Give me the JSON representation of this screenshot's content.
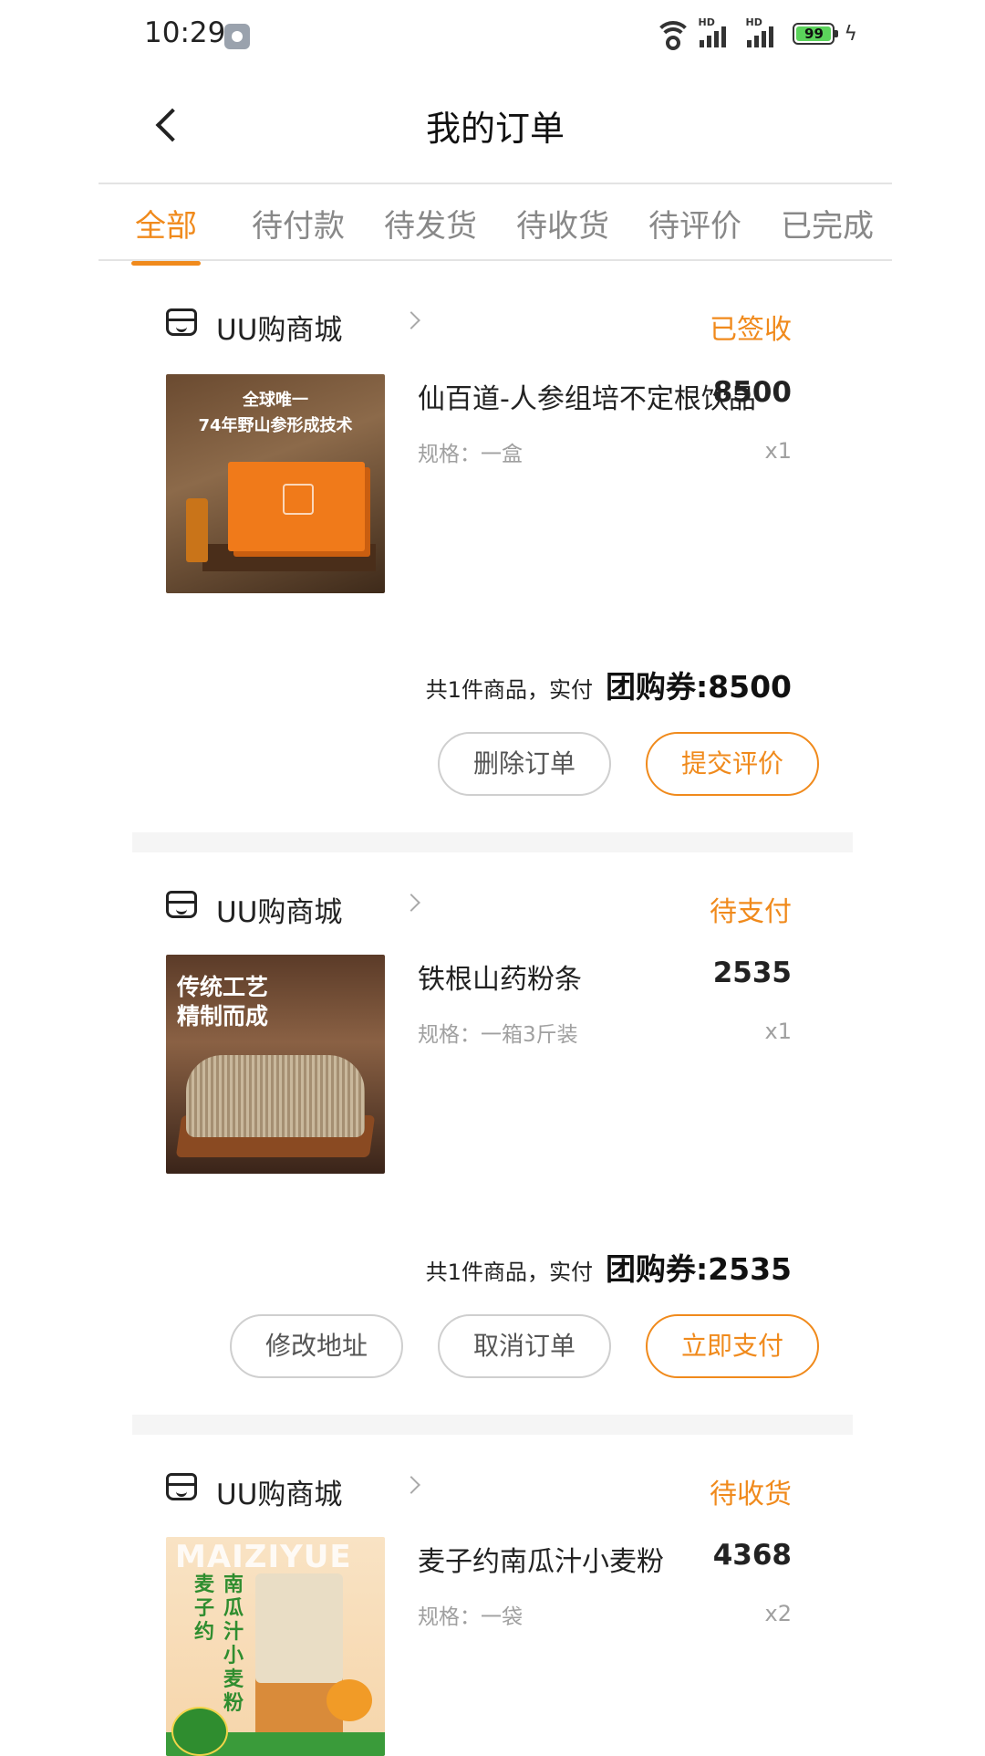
{
  "status_bar": {
    "time": "10:29",
    "battery": "99",
    "signal_label": "HD"
  },
  "header": {
    "title": "我的订单"
  },
  "tabs": [
    {
      "label": "全部",
      "active": true
    },
    {
      "label": "待付款",
      "active": false
    },
    {
      "label": "待发货",
      "active": false
    },
    {
      "label": "待收货",
      "active": false
    },
    {
      "label": "待评价",
      "active": false
    },
    {
      "label": "已完成",
      "active": false
    }
  ],
  "colors": {
    "accent": "#f08a1c",
    "muted": "#a0a0a0"
  },
  "orders": [
    {
      "shop": "UU购商城",
      "status": "已签收",
      "product": {
        "name": "仙百道-人参组培不定根饮品",
        "price": "8500",
        "spec": "规格：一盒",
        "qty": "x1",
        "image_text": [
          "全球唯一",
          "74年野山参形成技术"
        ]
      },
      "summary": {
        "count_text": "共1件商品，实付",
        "total": "团购券:8500"
      },
      "buttons": [
        "删除订单",
        "提交评价"
      ]
    },
    {
      "shop": "UU购商城",
      "status": "待支付",
      "product": {
        "name": "铁根山药粉条",
        "price": "2535",
        "spec": "规格：一箱3斤装",
        "qty": "x1",
        "image_text": [
          "传统工艺",
          "精制而成"
        ]
      },
      "summary": {
        "count_text": "共1件商品，实付",
        "total": "团购券:2535"
      },
      "buttons": [
        "修改地址",
        "取消订单",
        "立即支付"
      ]
    },
    {
      "shop": "UU购商城",
      "status": "待收货",
      "product": {
        "name": "麦子约南瓜汁小麦粉",
        "price": "4368",
        "spec": "规格：一袋",
        "qty": "x2",
        "image_text": [
          "MAIZIYUE",
          "麦子约",
          "南瓜汁小麦粉"
        ]
      }
    }
  ]
}
